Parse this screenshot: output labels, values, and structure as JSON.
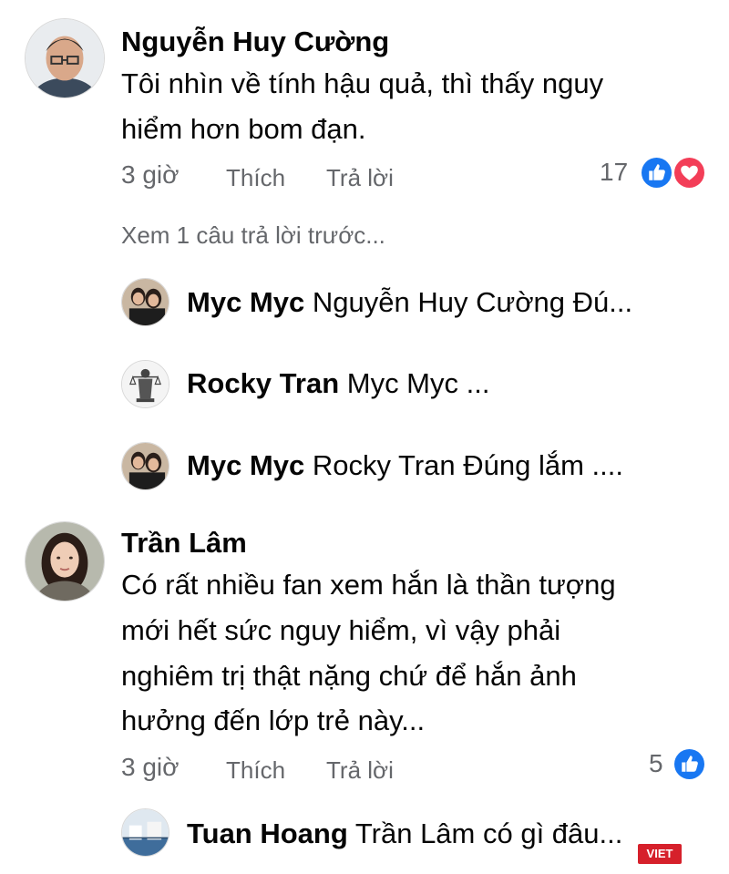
{
  "comments": [
    {
      "author": "Nguyễn Huy Cường",
      "lines": [
        "Tôi nhìn về tính hậu quả, thì thấy nguy",
        "hiểm hơn bom đạn."
      ],
      "time": "3 giờ",
      "like_label": "Thích",
      "reply_label": "Trả lời",
      "reaction_count": "17",
      "reactions": [
        "like-icon",
        "love-icon"
      ],
      "view_previous": "Xem 1 câu trả lời trước...",
      "replies": [
        {
          "author": "Myc Myc",
          "text": "Nguyễn Huy Cường  Đú..."
        },
        {
          "author": "Rocky Tran",
          "text": "Myc Myc ..."
        },
        {
          "author": "Myc Myc",
          "text": "Rocky Tran  Đúng lắm ...."
        }
      ]
    },
    {
      "author": "Trần Lâm",
      "lines": [
        "Có rất nhiều fan xem hắn là thần tượng",
        "mới hết sức nguy hiểm, vì vậy phải",
        "nghiêm trị thật nặng chứ để hắn ảnh",
        "hưởng đến lớp trẻ này..."
      ],
      "time": "3 giờ",
      "like_label": "Thích",
      "reply_label": "Trả lời",
      "reaction_count": "5",
      "reactions": [
        "like-icon"
      ],
      "replies": [
        {
          "author": "Tuan Hoang",
          "text": "Trần Lâm có gì đâu..."
        }
      ]
    }
  ],
  "watermark": "VIET",
  "colors": {
    "text": "#050505",
    "meta": "#65676b",
    "like_blue": "#1877f2",
    "love_red": "#f33e58",
    "watermark_red": "#d6202b"
  }
}
